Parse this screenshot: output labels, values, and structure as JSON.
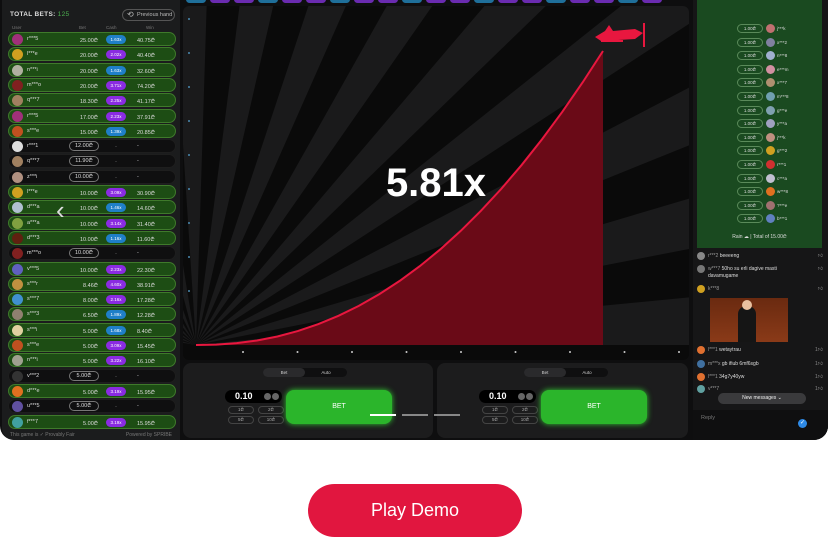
{
  "bets": {
    "title": "TOTAL BETS:",
    "count": "125",
    "prev_hand": "Previous hand",
    "cols": [
      "User",
      "Bet",
      "Cash",
      "Win"
    ],
    "rows": [
      [
        "r***5",
        "25.00₾",
        "1.63x",
        "40.75₾"
      ],
      [
        "l***e",
        "20.00₾",
        "2.02x",
        "40.40₾"
      ],
      [
        "n***i",
        "20.00₾",
        "1.63x",
        "32.60₾"
      ],
      [
        "m***o",
        "20.00₾",
        "3.71x",
        "74.20₾"
      ],
      [
        "q***7",
        "18.30₾",
        "2.25x",
        "41.17₾"
      ],
      [
        "r***5",
        "17.00₾",
        "2.23x",
        "37.91₾"
      ],
      [
        "s***e",
        "15.00₾",
        "1.39x",
        "20.85₾"
      ],
      [
        "r***1",
        "12.00₾",
        "-",
        "-"
      ],
      [
        "q***7",
        "11.90₾",
        "-",
        "-"
      ],
      [
        "z***i",
        "10.00₾",
        "-",
        "-"
      ],
      [
        "l***e",
        "10.00₾",
        "3.09x",
        "30.90₾"
      ],
      [
        "d***a",
        "10.00₾",
        "1.46x",
        "14.60₾"
      ],
      [
        "a***a",
        "10.00₾",
        "3.14x",
        "31.40₾"
      ],
      [
        "d***3",
        "10.00₾",
        "1.16x",
        "11.60₾"
      ],
      [
        "m***o",
        "10.00₾",
        "-",
        "-"
      ],
      [
        "v***5",
        "10.00₾",
        "2.23x",
        "22.30₾"
      ],
      [
        "s***r",
        "8.46₾",
        "4.60x",
        "38.91₾"
      ],
      [
        "s***7",
        "8.00₾",
        "2.16x",
        "17.28₾"
      ],
      [
        "s***3",
        "6.50₾",
        "1.89x",
        "12.28₾"
      ],
      [
        "s***i",
        "5.00₾",
        "1.68x",
        "8.40₾"
      ],
      [
        "s***e",
        "5.00₾",
        "3.09x",
        "15.45₾"
      ],
      [
        "n***i",
        "5.00₾",
        "3.22x",
        "16.10₾"
      ],
      [
        "v***2",
        "5.00₾",
        "-",
        "-"
      ],
      [
        "d***e",
        "5.00₾",
        "3.19x",
        "15.95₾"
      ],
      [
        "u***5",
        "5.00₾",
        "-",
        "-"
      ],
      [
        "f***7",
        "5.00₾",
        "3.19x",
        "15.95₾"
      ]
    ],
    "footer_left": "This game is ✓ Provably Fair",
    "footer_right": "Powered by SPRIBE"
  },
  "colors": {
    "low_mult": "#1f7fc8",
    "high_mult": "#8a2be2",
    "bet_green": "#2bb52b",
    "curve": "#e8173f",
    "play_demo": "#e1163f"
  },
  "game": {
    "multiplier": "5.81x",
    "plane_icon": "airplane-icon"
  },
  "panels": [
    {
      "tabs": [
        "Bet",
        "Auto"
      ],
      "amount": "0.10",
      "quick": [
        "1₾",
        "2₾",
        "5₾",
        "10₾"
      ],
      "bet": "BET"
    },
    {
      "tabs": [
        "Bet",
        "Auto"
      ],
      "amount": "0.10",
      "quick": [
        "1₾",
        "2₾",
        "5₾",
        "10₾"
      ],
      "bet": "BET"
    }
  ],
  "rain": {
    "items": [
      [
        "1.00₾",
        "j***k"
      ],
      [
        "1.00₾",
        "x***2"
      ],
      [
        "1.00₾",
        "n***8"
      ],
      [
        "1.00₾",
        "e***m"
      ],
      [
        "1.00₾",
        "x***7"
      ],
      [
        "1.00₾",
        "m***8"
      ],
      [
        "1.00₾",
        "g***e"
      ],
      [
        "1.00₾",
        "y***a"
      ],
      [
        "1.00₾",
        "j***k"
      ],
      [
        "1.00₾",
        "g***2"
      ],
      [
        "1.00₾",
        "r***1"
      ],
      [
        "1.00₾",
        "c***a"
      ],
      [
        "1.00₾",
        "w***8"
      ],
      [
        "1.00₾",
        "?***e"
      ],
      [
        "1.00₾",
        "b***1"
      ]
    ],
    "footer": "Rain ☁ | Total of 15.00₾"
  },
  "chat": {
    "messages": [
      {
        "user": "r***2",
        "text": "beeeeng",
        "likes": ""
      },
      {
        "user": "w***7",
        "text": "50ho su erli dagive masti davamugame",
        "likes": ""
      },
      {
        "user": "k***8",
        "text": "",
        "likes": ""
      },
      {
        "user": "l***1",
        "text": "wetaytrau",
        "likes": "1"
      },
      {
        "user": "m***x",
        "text": "gb ifiub 6mf6sgb",
        "likes": "1"
      },
      {
        "user": "l***1",
        "text": "34g7y40yw",
        "likes": "1"
      },
      {
        "user": "v***7",
        "text": "",
        "likes": "1"
      }
    ],
    "new_messages": "New messages ⌄",
    "reply_placeholder": "Reply"
  },
  "play_demo": "Play Demo"
}
